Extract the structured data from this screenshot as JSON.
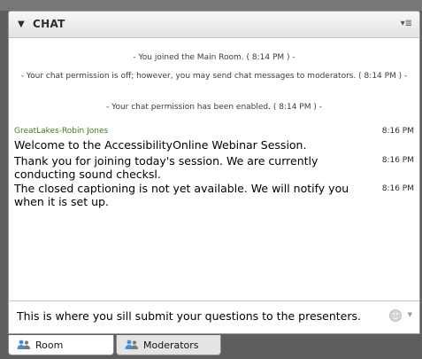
{
  "panel": {
    "title": "CHAT",
    "collapse_icon": "caret-down-icon",
    "menu_icon": "panel-menu-icon"
  },
  "system_messages": [
    "- You joined the Main Room. ( 8:14 PM ) -",
    "- Your chat permission is off; however, you may send chat messages to moderators. ( 8:14 PM ) -",
    "- Your chat permission has been enabled. ( 8:14 PM ) -"
  ],
  "chat": {
    "sender": "GreatLakes-Robin Jones",
    "messages": [
      {
        "text": "Welcome to the AccessibilityOnline Webinar Session.",
        "time": "8:16 PM"
      },
      {
        "text": "Thank you for joining today's session. We are currently conducting sound checksl.",
        "time": "8:16 PM"
      },
      {
        "text": "The closed captioning is not yet available. We will notify you when it is set up.",
        "time": "8:16 PM"
      }
    ]
  },
  "input": {
    "value": "This is where you sill submit your questions to the presenters."
  },
  "tabs": [
    {
      "label": "Room",
      "icon": "users-icon",
      "active": true
    },
    {
      "label": "Moderators",
      "icon": "users-icon",
      "active": false
    }
  ],
  "colors": {
    "sender": "#3f7a1e",
    "background": "#5e5e5e"
  }
}
